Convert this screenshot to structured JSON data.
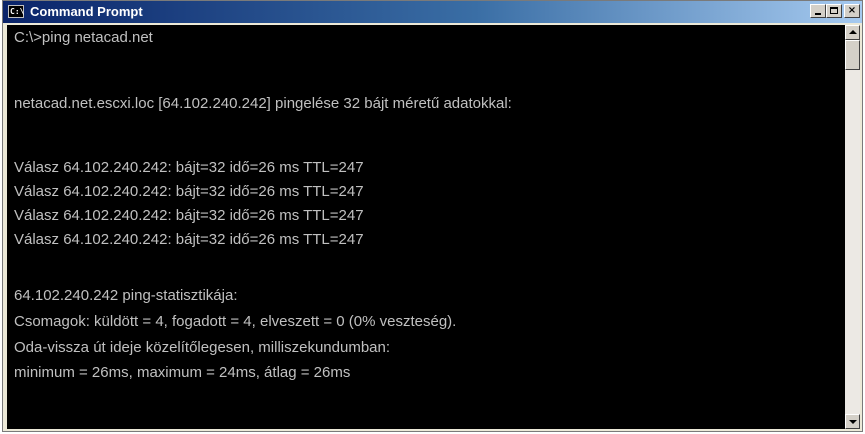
{
  "window": {
    "title": "Command Prompt",
    "icon": "cmd-icon",
    "controls": {
      "minimize": "minimize-icon",
      "maximize": "maximize-icon",
      "close_label": "×"
    }
  },
  "console": {
    "lines": [
      "C:\\>ping netacad.net",
      "",
      "netacad.net.escxi.loc [64.102.240.242] pingelése 32 bájt méretű adatokkal:",
      "",
      "Válasz 64.102.240.242: bájt=32 idő=26 ms TTL=247",
      "Válasz 64.102.240.242: bájt=32 idő=26 ms TTL=247",
      "Válasz 64.102.240.242: bájt=32 idő=26 ms TTL=247",
      "Válasz 64.102.240.242: bájt=32 idő=26 ms TTL=247",
      "",
      "64.102.240.242 ping-statisztikája:",
      "Csomagok: küldött = 4, fogadott = 4, elveszett = 0 (0% veszteség).",
      "Oda-vissza út ideje közelítőlegesen, milliszekundumban:",
      "minimum = 26ms, maximum = 24ms, átlag = 26ms"
    ]
  },
  "colors": {
    "console_background": "#000000",
    "console_text": "#c0c0c0",
    "titlebar_start": "#0a246a",
    "titlebar_end": "#a6caf0"
  }
}
